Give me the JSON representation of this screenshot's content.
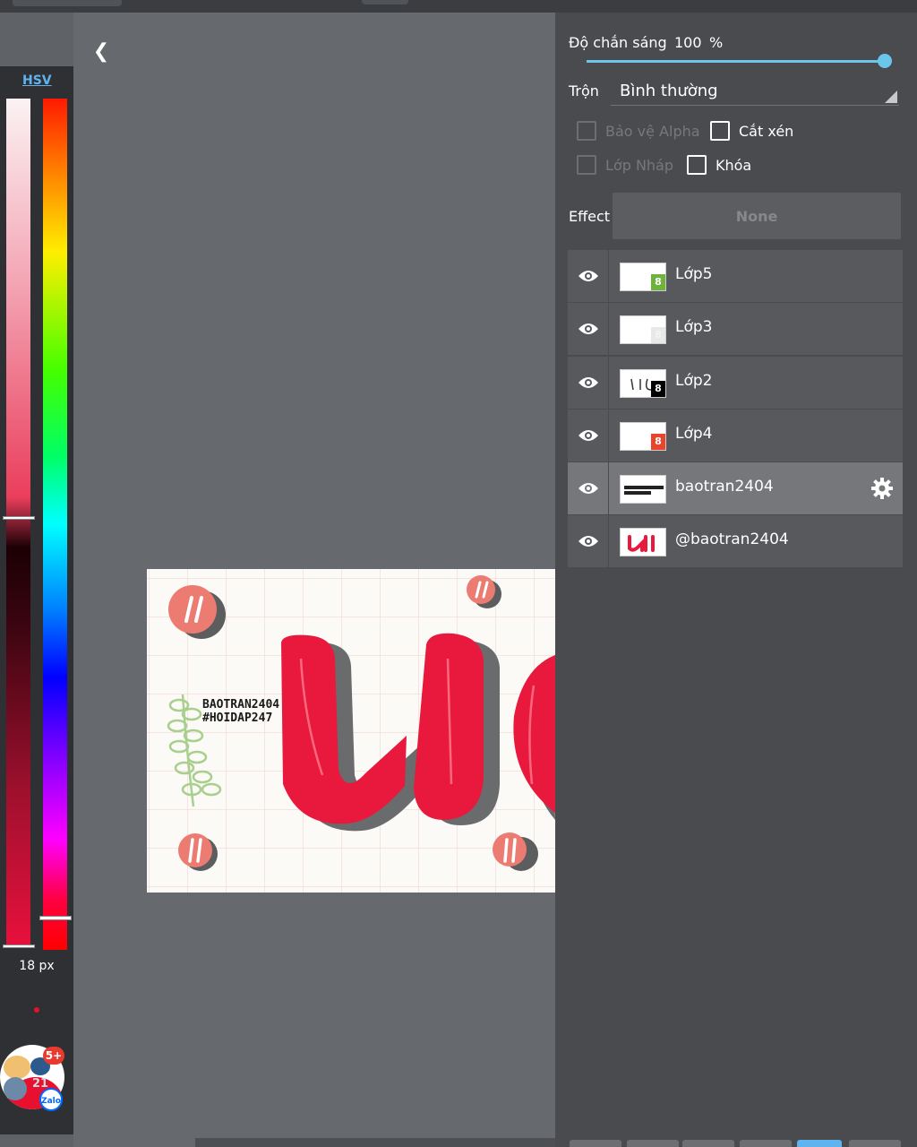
{
  "toolbar": {
    "back_icon": "chevron-left-icon"
  },
  "color_panel": {
    "mode_tab": "HSV",
    "brush_size": "18 px",
    "brush_color": "#e8102f"
  },
  "chat_bubble": {
    "badge": "5+",
    "count": "21",
    "app": "Zalo"
  },
  "drawing": {
    "watermark_line1": "BAOTRAN2404",
    "watermark_line2": "#HOIDAP247",
    "accent_color": "#e8193c"
  },
  "layer_panel": {
    "opacity_label": "Độ chắn sáng",
    "opacity_value": "100",
    "opacity_unit": "%",
    "opacity_level": 1.0,
    "blend_label": "Trộn",
    "blend_value": "Bình thường",
    "checkboxes": {
      "protect_alpha": "Bảo vệ Alpha",
      "clipping": "Cắt xén",
      "draft_layer": "Lớp Nháp",
      "lock": "Khóa"
    },
    "effect_label": "Effect",
    "effect_value": "None",
    "layers": [
      {
        "name": "Lớp5",
        "badge": "8",
        "badge_color": "#6fb23c",
        "visible": true,
        "selected": false
      },
      {
        "name": "Lớp3",
        "badge": "8",
        "badge_color": "#e8e8e8",
        "visible": true,
        "selected": false
      },
      {
        "name": "Lớp2",
        "badge": "8",
        "badge_color": "#000000",
        "visible": true,
        "selected": false
      },
      {
        "name": "Lớp4",
        "badge": "8",
        "badge_color": "#e8452f",
        "visible": true,
        "selected": false
      },
      {
        "name": "baotran2404",
        "badge": "",
        "badge_color": "",
        "visible": true,
        "selected": true
      },
      {
        "name": "@baotran2404",
        "badge": "",
        "badge_color": "",
        "visible": true,
        "selected": false
      }
    ]
  }
}
